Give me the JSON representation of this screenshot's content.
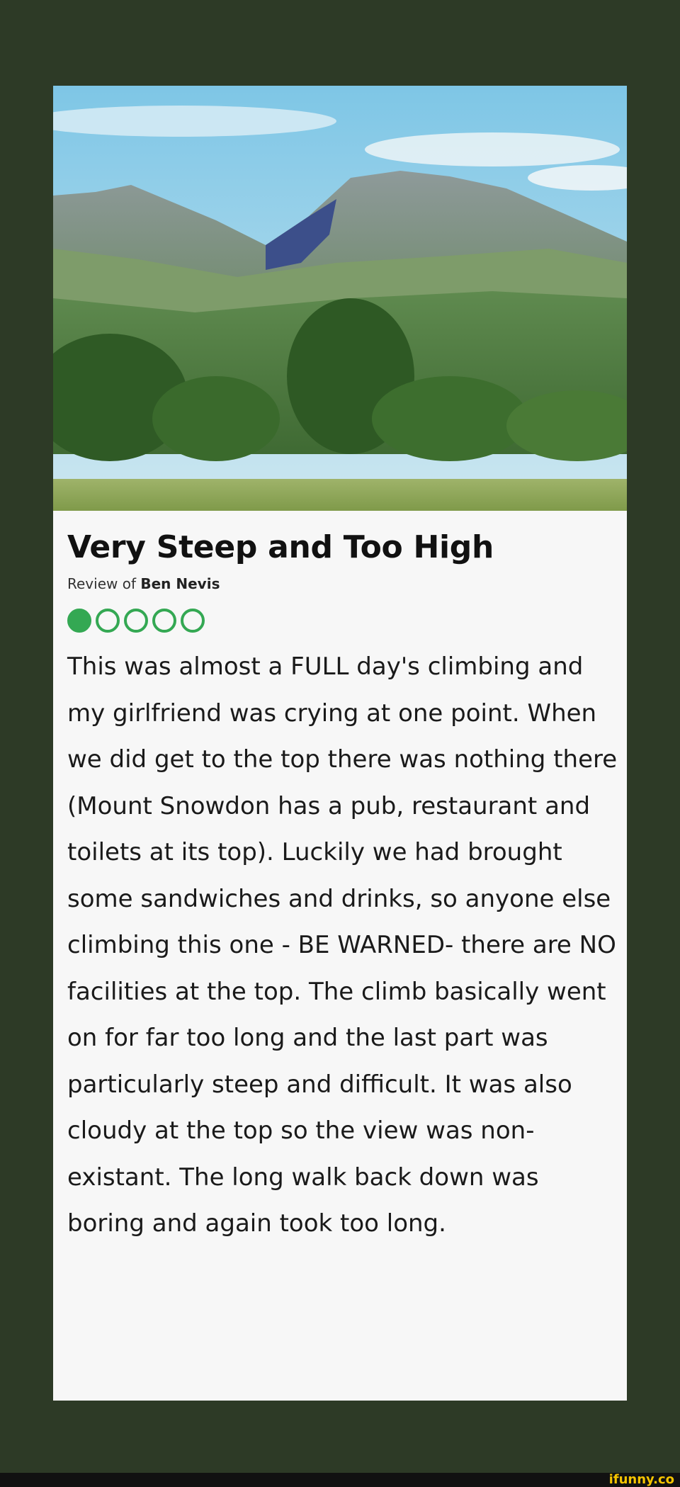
{
  "review": {
    "title": "Very Steep and Too High",
    "subtitle_prefix": "Review of ",
    "subtitle_place": "Ben Nevis",
    "rating_filled": 1,
    "rating_total": 5,
    "rating_color": "#34a853",
    "text": "This was almost a FULL day's climbing and my girlfriend was crying at one point. When we did get to the top there was nothing there (Mount Snowdon has a pub, restaurant and toilets at its top). Luckily we had brought some sandwiches and drinks, so anyone else climbing this one - BE WARNED- there are NO facilities at the top. The climb basically went on for far too long and the last part was particularly steep and difficult. It was also cloudy at the top so the view was non-existant. The long walk back down was boring and again took too long."
  },
  "watermark": "ifunny.co"
}
